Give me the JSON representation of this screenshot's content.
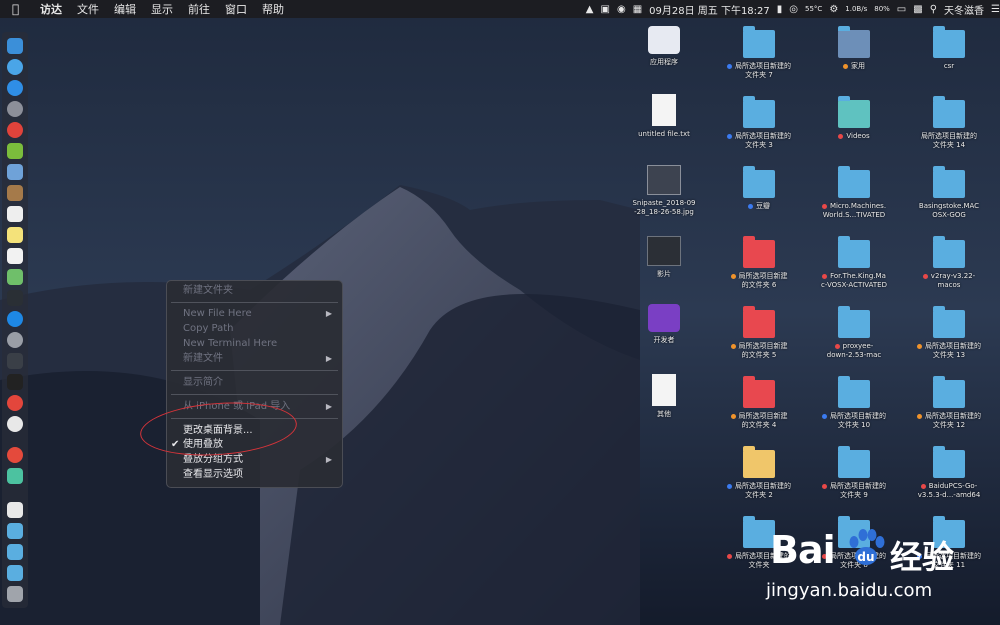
{
  "menubar": {
    "app_name": "访达",
    "menus": [
      "文件",
      "编辑",
      "显示",
      "前往",
      "窗口",
      "帮助"
    ],
    "datetime": "09月28日 周五 下午18:27",
    "temp": "55°C",
    "net_speed": "1.0B/s",
    "battery": "80%",
    "user": "天冬滋香"
  },
  "context_menu": {
    "items": [
      {
        "label": "新建文件夹",
        "enabled": false
      },
      {
        "label": "New File Here",
        "enabled": false,
        "submenu": true
      },
      {
        "label": "Copy Path",
        "enabled": false
      },
      {
        "label": "New Terminal Here",
        "enabled": false
      },
      {
        "label": "新建文件",
        "enabled": false,
        "submenu": true
      },
      {
        "label": "显示简介",
        "enabled": false
      },
      {
        "label": "从 iPhone 或 iPad 导入",
        "enabled": false,
        "submenu": true
      },
      {
        "label": "更改桌面背景...",
        "enabled": true
      },
      {
        "label": "使用叠放",
        "enabled": true,
        "checked": true
      },
      {
        "label": "叠放分组方式",
        "enabled": true,
        "submenu": true
      },
      {
        "label": "查看显示选项",
        "enabled": true
      }
    ]
  },
  "desktop": {
    "col1": [
      {
        "label": "应用程序"
      },
      {
        "label": "untitled file.txt"
      },
      {
        "label": "Snipaste_2018-09\n-28_18-26-58.jpg"
      },
      {
        "label": "影片"
      },
      {
        "label": "开发者"
      },
      {
        "label": "其他"
      }
    ],
    "col2": [
      {
        "label": "局所选项目新建的\n文件夹 7"
      },
      {
        "label": "局所选项目新建的\n文件夹 3"
      },
      {
        "label": "豆瓣"
      },
      {
        "label": "局所选项目新建\n的文件夹 6"
      },
      {
        "label": "局所选项目新建\n的文件夹 5"
      },
      {
        "label": "局所选项目新建\n的文件夹 4"
      },
      {
        "label": "局所选项目新建的\n文件夹 2"
      },
      {
        "label": "局所选项目新建的\n文件夹"
      }
    ],
    "col3": [
      {
        "label": "家用"
      },
      {
        "label": "Videos"
      },
      {
        "label": "Micro.Machines.\nWorld.S...TIVATED"
      },
      {
        "label": "For.The.King.Ma\nc-VOSX-ACTIVATED"
      },
      {
        "label": "proxyee-\ndown-2.53-mac"
      },
      {
        "label": "局所选项目新建的\n文件夹 10"
      },
      {
        "label": "局所选项目新建的\n文件夹 9"
      },
      {
        "label": "局所选项目新建的\n文件夹 8"
      }
    ],
    "col4": [
      {
        "label": "csr"
      },
      {
        "label": "局所选项目新建的\n文件夹 14"
      },
      {
        "label": "Basingstoke.MAC\nOSX-GOG"
      },
      {
        "label": "v2ray-v3.22-\nmacos"
      },
      {
        "label": "局所选项目新建的\n文件夹 13"
      },
      {
        "label": "局所选项目新建的\n文件夹 12"
      },
      {
        "label": "BaiduPCS-Go-\nv3.5.3-d...-amd64"
      },
      {
        "label": "局所选项目新建的\n文件夹 11"
      }
    ]
  },
  "watermark": {
    "brand": "Bai",
    "brand2": "du",
    "cn": "经验",
    "url": "jingyan.baidu.com"
  },
  "colors": {
    "highlight_circle": "#d4343a",
    "folder_blue": "#5aaee0"
  }
}
